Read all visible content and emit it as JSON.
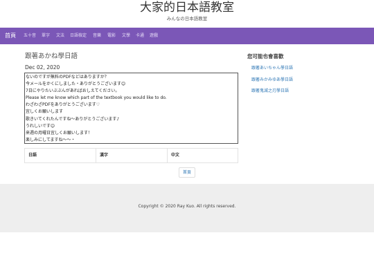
{
  "header": {
    "title": "大家的日本語教室",
    "subtitle": "みんなの日本語教室"
  },
  "nav": {
    "items": [
      {
        "label": "首頁",
        "active": true
      },
      {
        "label": "五十音"
      },
      {
        "label": "單字"
      },
      {
        "label": "文法"
      },
      {
        "label": "日語檢定"
      },
      {
        "label": "音樂"
      },
      {
        "label": "電影"
      },
      {
        "label": "文學"
      },
      {
        "label": "卡通"
      },
      {
        "label": "遊戲"
      }
    ]
  },
  "post": {
    "title": "跟著あかね學日語",
    "date": "Dec 02, 2020",
    "lines": [
      "ないのですが無料のPDFなどはありますか？",
      "今メールをかくにしました・ありがとうございます😊",
      "7日にやりたいぶぶんがあればおしえてください。",
      "Please let me know which part of the textbook you would like to do.",
      "わざわざPDFをありがとうございます♡",
      "宜しくお願いします",
      "歌きいてくれたんですね〜ありがとうございます♪",
      "うれしいです😊",
      "来週の月曜日宜しくお願いします！",
      "楽しみにしてますね〜〜・"
    ]
  },
  "vocab_table": {
    "headers": [
      "日語",
      "漢字",
      "中文"
    ]
  },
  "pagination": {
    "home_label": "首頁"
  },
  "sidebar": {
    "heading": "您可能也會喜歡",
    "links": [
      "跟著あいちゃん學日語",
      "跟著みかみゆあ學日語",
      "跟著鬼滅之刃學日語"
    ]
  },
  "footer": {
    "copyright": "Copyright © 2020 Ray Kuo. All rights reserved."
  },
  "colors": {
    "navbar": "#7b57b7",
    "link": "#337ab7",
    "footer": "#eeeeee"
  }
}
